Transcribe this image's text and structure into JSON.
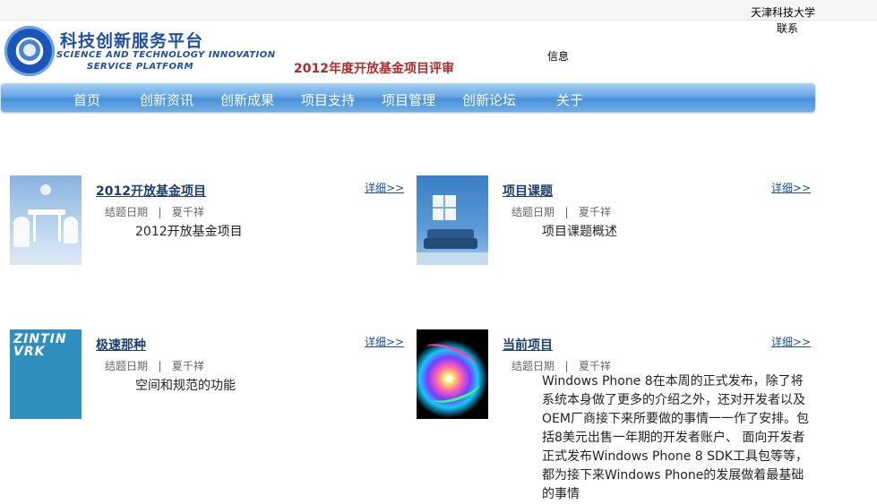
{
  "header": {
    "university": "天津科技大学",
    "contact": "联系",
    "info": "信息",
    "subtitle": "2012年度开放基金项目评审",
    "logo_title": "科技创新服务平台",
    "logo_en_line1": "SCIENCE AND TECHNOLOGY INNOVATION",
    "logo_en_line2": "SERVICE PLATFORM"
  },
  "nav": {
    "items": [
      {
        "label": "首页"
      },
      {
        "label": "创新资讯"
      },
      {
        "label": "创新成果"
      },
      {
        "label": "项目支持"
      },
      {
        "label": "项目管理"
      },
      {
        "label": "创新论坛"
      },
      {
        "label": "关于"
      }
    ]
  },
  "cards": [
    {
      "title": "2012开放基金项目",
      "detail": "详细>>",
      "meta": "结题日期   |   夏千祥",
      "desc": "2012开放基金项目"
    },
    {
      "title": "项目课题",
      "detail": "详细>>",
      "meta": "结题日期   |   夏千祥",
      "desc": "项目课题概述"
    },
    {
      "title": "极速那种",
      "detail": "详细>>",
      "meta": "结题日期   |   夏千祥",
      "desc": "空间和规范的功能"
    },
    {
      "title": "当前项目",
      "detail": "详细>>",
      "meta": "结题日期   |   夏千祥",
      "desc": "Windows Phone 8在本周的正式发布，除了将系统本身做了更多的介绍之外，还对开发者以及OEM厂商接下来所要做的事情一一作了安排。包括8美元出售一年期的开发者账户、 面向开发者正式发布Windows Phone 8 SDK工具包等等，都为接下来Windows Phone的发展做着最基础的事情"
    }
  ],
  "images": {
    "card3_text": "ZINTIN VRK"
  },
  "colors": {
    "nav_bg": "#66a8e6",
    "title": "#1b3f6e",
    "subtitle": "#b22a2a",
    "link": "#1a4da0"
  }
}
